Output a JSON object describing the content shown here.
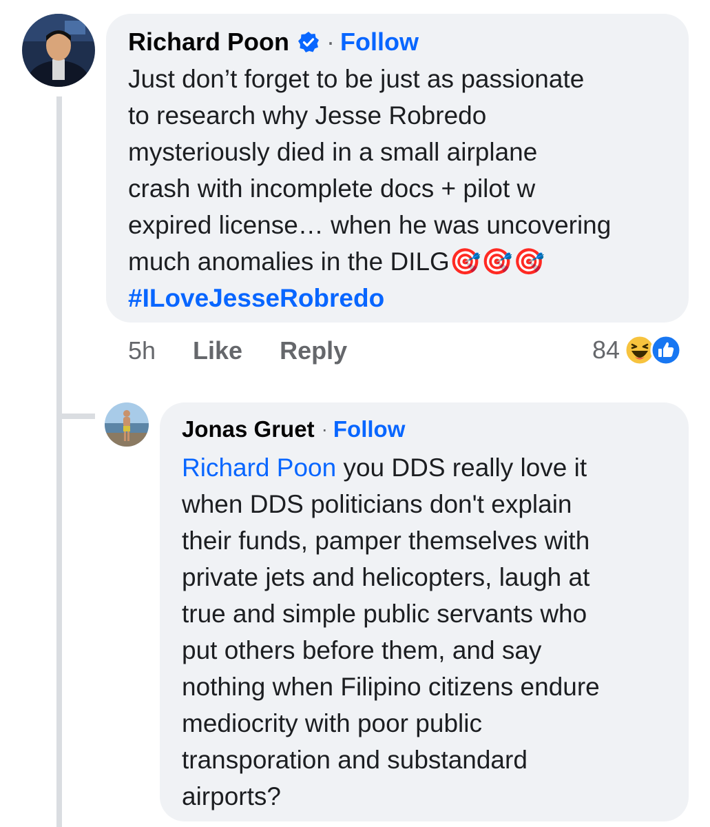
{
  "comment": {
    "author": "Richard Poon",
    "verified_icon": "verified-badge-icon",
    "separator": "·",
    "follow_label": "Follow",
    "lines": [
      "Just don’t forget to be just as passionate",
      "to research why Jesse Robredo",
      "mysteriously died in a small airplane",
      "crash with incomplete docs + pilot w",
      "expired license… when he was uncovering",
      "much anomalies in the DILG"
    ],
    "emoji": "🎯🎯🎯",
    "hashtag": "#ILoveJesseRobredo",
    "time": "5h",
    "like_label": "Like",
    "reply_label": "Reply",
    "reaction_count": "84",
    "reaction_icons": [
      "haha-reaction-icon",
      "like-reaction-icon"
    ]
  },
  "reply": {
    "author": "Jonas Gruet",
    "separator": "·",
    "follow_label": "Follow",
    "mention": "Richard Poon",
    "first_line_rest": " you DDS really love it",
    "lines": [
      "when DDS politicians don't explain",
      "their funds, pamper themselves with",
      "private jets and helicopters, laugh at",
      "true and simple public servants who",
      "put others before them, and say",
      "nothing when Filipino citizens endure",
      "mediocrity with poor public",
      "transporation and substandard",
      "airports?"
    ]
  },
  "colors": {
    "bubble_bg": "#f0f2f5",
    "link_blue": "#0866ff",
    "meta_gray": "#65676b",
    "thread_line": "#dadde1"
  }
}
